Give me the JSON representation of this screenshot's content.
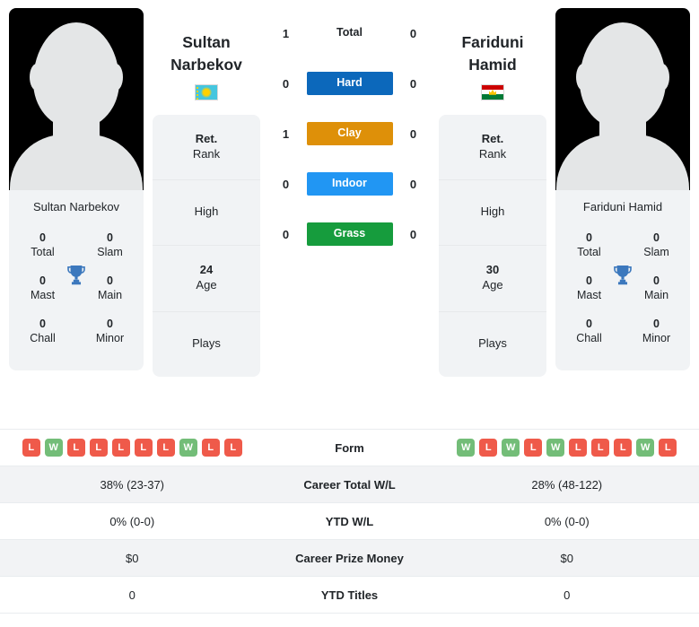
{
  "players": [
    {
      "id": "left",
      "first_name": "Sultan",
      "last_name": "Narbekov",
      "full_name": "Sultan Narbekov",
      "country_flag": "kazakhstan-flag",
      "photo_alt": "player-silhouette",
      "titles": [
        {
          "value": "0",
          "label": "Total"
        },
        {
          "value": "0",
          "label": "Slam"
        },
        {
          "value": "0",
          "label": "Mast"
        },
        {
          "value": "0",
          "label": "Main"
        },
        {
          "value": "0",
          "label": "Chall"
        },
        {
          "value": "0",
          "label": "Minor"
        }
      ],
      "info": [
        {
          "value": "Ret.",
          "label": "Rank"
        },
        {
          "value": "",
          "label": "High"
        },
        {
          "value": "24",
          "label": "Age"
        },
        {
          "value": "",
          "label": "Plays"
        }
      ],
      "form": [
        "L",
        "W",
        "L",
        "L",
        "L",
        "L",
        "L",
        "W",
        "L",
        "L"
      ],
      "career_total_wl": "38% (23-37)",
      "ytd_wl": "0% (0-0)",
      "career_prize_money": "$0",
      "ytd_titles": "0"
    },
    {
      "id": "right",
      "first_name": "Fariduni",
      "last_name": "Hamid",
      "full_name": "Fariduni Hamid",
      "country_flag": "tajikistan-flag",
      "photo_alt": "player-silhouette",
      "titles": [
        {
          "value": "0",
          "label": "Total"
        },
        {
          "value": "0",
          "label": "Slam"
        },
        {
          "value": "0",
          "label": "Mast"
        },
        {
          "value": "0",
          "label": "Main"
        },
        {
          "value": "0",
          "label": "Chall"
        },
        {
          "value": "0",
          "label": "Minor"
        }
      ],
      "info": [
        {
          "value": "Ret.",
          "label": "Rank"
        },
        {
          "value": "",
          "label": "High"
        },
        {
          "value": "30",
          "label": "Age"
        },
        {
          "value": "",
          "label": "Plays"
        }
      ],
      "form": [
        "W",
        "L",
        "W",
        "L",
        "W",
        "L",
        "L",
        "L",
        "W",
        "L"
      ],
      "career_total_wl": "28% (48-122)",
      "ytd_wl": "0% (0-0)",
      "career_prize_money": "$0",
      "ytd_titles": "0"
    }
  ],
  "head_to_head": [
    {
      "surface": "Total",
      "left": "1",
      "right": "0",
      "color": ""
    },
    {
      "surface": "Hard",
      "left": "0",
      "right": "0",
      "color": "#0c68bb"
    },
    {
      "surface": "Clay",
      "left": "1",
      "right": "0",
      "color": "#de9009"
    },
    {
      "surface": "Indoor",
      "left": "0",
      "right": "0",
      "color": "#2196f3"
    },
    {
      "surface": "Grass",
      "left": "0",
      "right": "0",
      "color": "#169c3d"
    }
  ],
  "table_rows": [
    {
      "label": "Form",
      "key": "form"
    },
    {
      "label": "Career Total W/L",
      "key": "career_total_wl"
    },
    {
      "label": "YTD W/L",
      "key": "ytd_wl"
    },
    {
      "label": "Career Prize Money",
      "key": "career_prize_money"
    },
    {
      "label": "YTD Titles",
      "key": "ytd_titles"
    }
  ],
  "colors": {
    "win_badge": "#73bd78",
    "loss_badge": "#ef5a4a",
    "card_bg": "#f1f3f5",
    "row_alt_bg": "#f2f3f5",
    "trophy": "#3c78bd"
  }
}
